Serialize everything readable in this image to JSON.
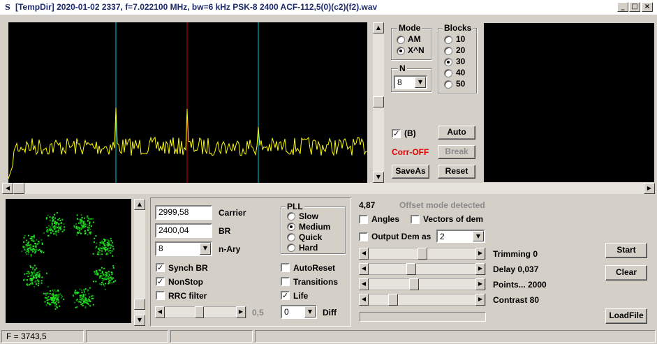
{
  "window": {
    "icon_glyph": "S",
    "title": "[TempDir] 2020-01-02 2337, f=7.022100 MHz, bw=6 kHz PSK-8 2400 ACF-112,5(0)(c2)(f2).wav",
    "min_glyph": "_",
    "max_glyph": "□",
    "close_glyph": "×"
  },
  "mode": {
    "title": "Mode",
    "options": [
      "AM",
      "X^N"
    ],
    "selected": "X^N"
  },
  "blocks": {
    "title": "Blocks",
    "options": [
      "10",
      "20",
      "30",
      "40",
      "50"
    ],
    "selected": "30"
  },
  "n": {
    "title": "N",
    "value": "8"
  },
  "b_check": {
    "label": "(B)",
    "checked": true
  },
  "corr_status": "Corr-OFF",
  "buttons": {
    "auto": "Auto",
    "break": "Break",
    "saveas": "SaveAs",
    "reset": "Reset",
    "start": "Start",
    "clear": "Clear",
    "loadfile": "LoadFile"
  },
  "params": {
    "carrier_value": "2999,58",
    "carrier_label": "Carrier",
    "br_value": "2400,04",
    "br_label": "BR",
    "nary_value": "8",
    "nary_label": "n-Ary",
    "synch_br": "Synch BR",
    "nonstop": "NonStop",
    "rrc_filter": "RRC filter",
    "slider_value": "0,5",
    "diff_value": "0",
    "diff_label": "Diff"
  },
  "pll": {
    "title": "PLL",
    "options": [
      "Slow",
      "Medium",
      "Quick",
      "Hard"
    ],
    "selected": "Medium"
  },
  "options": {
    "autoreset": "AutoReset",
    "transitions": "Transitions",
    "life": "Life"
  },
  "analysis": {
    "value": "4,87",
    "status": "Offset mode detected",
    "angles": "Angles",
    "vectors": "Vectors of dem",
    "output_dem": "Output Dem as",
    "output_dem_value": "2",
    "trimming": "Trimming 0",
    "delay": "Delay  0,037",
    "points": "Points... 2000",
    "contrast": "Contrast 80"
  },
  "status": {
    "freq": "F = 3743,5"
  },
  "colors": {
    "spectrum_trace": "#ffff00",
    "cyan_marker": "#00c8d8",
    "red_marker": "#d00000",
    "constellation": "#22e022"
  }
}
